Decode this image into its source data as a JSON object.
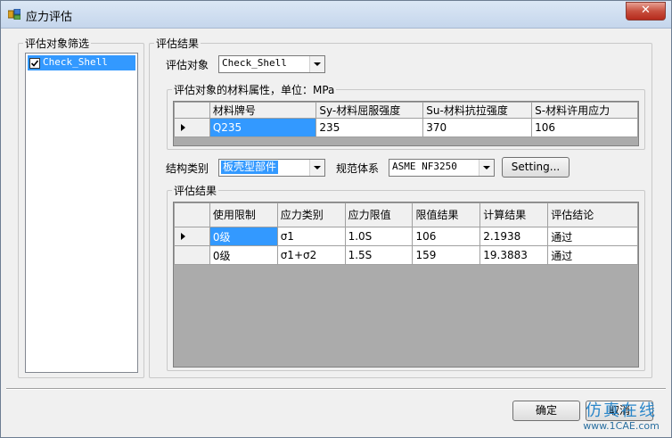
{
  "window": {
    "title": "应力评估",
    "close_label": "✕"
  },
  "filter_group": {
    "title": "评估对象筛选",
    "items": [
      {
        "label": "Check_Shell",
        "checked": true,
        "selected": true
      }
    ]
  },
  "results_group": {
    "title": "评估结果"
  },
  "object_selector": {
    "label": "评估对象",
    "value": "Check_Shell"
  },
  "material": {
    "title": "评估对象的材料属性，单位：MPa",
    "columns": [
      "材料牌号",
      "Sy-材料屈服强度",
      "Su-材料抗拉强度",
      "S-材料许用应力"
    ],
    "rows": [
      [
        "Q235",
        "235",
        "370",
        "106"
      ]
    ]
  },
  "structure": {
    "label": "结构类别",
    "value": "板壳型部件"
  },
  "code": {
    "label": "规范体系",
    "value": "ASME NF3250",
    "settings_label": "Setting..."
  },
  "evaluation": {
    "title": "评估结果",
    "columns": [
      "使用限制",
      "应力类别",
      "应力限值",
      "限值结果",
      "计算结果",
      "评估结论"
    ],
    "rows": [
      [
        "0级",
        "σ1",
        "1.0S",
        "106",
        "2.1938",
        "通过"
      ],
      [
        "0级",
        "σ1+σ2",
        "1.5S",
        "159",
        "19.3883",
        "通过"
      ]
    ]
  },
  "footer": {
    "ok_label": "确定",
    "cancel_label": "取消"
  },
  "watermark": {
    "line1": "仿真在线",
    "line2": "www.1CAE.com"
  },
  "colors": {
    "selection": "#3399ff",
    "grid_background": "#ababab",
    "close_button": "#c8503f"
  }
}
